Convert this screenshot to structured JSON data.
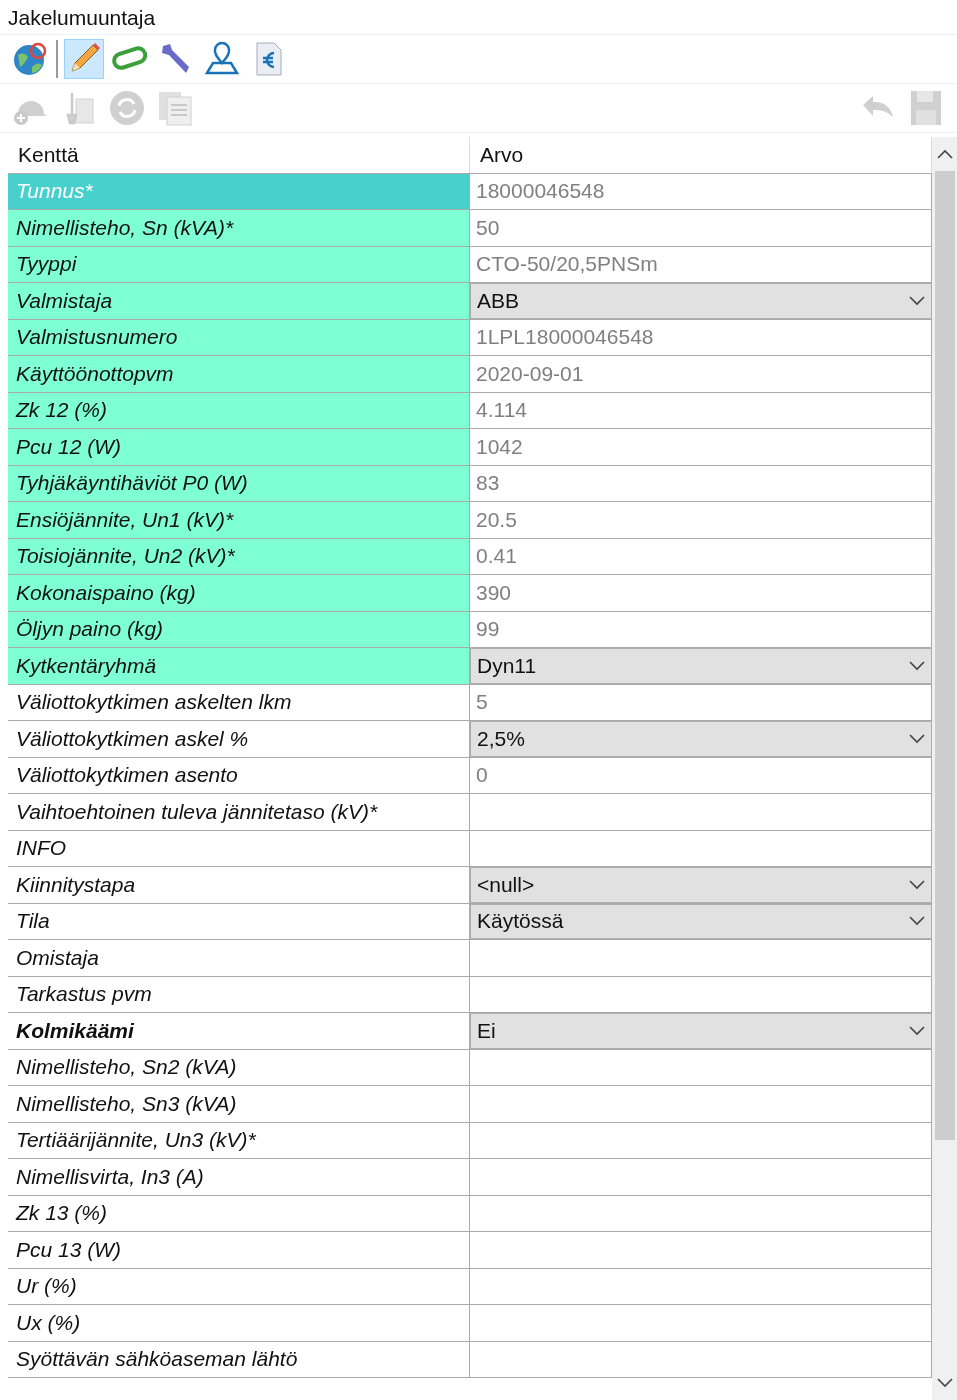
{
  "window": {
    "title": "Jakelumuuntaja"
  },
  "toolbar": [
    {
      "kind": "globe",
      "selected": false
    },
    {
      "kind": "pencil",
      "selected": true
    },
    {
      "kind": "clip",
      "selected": false
    },
    {
      "kind": "wrench",
      "selected": false
    },
    {
      "kind": "map",
      "selected": false
    },
    {
      "kind": "euro",
      "selected": false
    }
  ],
  "actions_left": [
    {
      "kind": "helmet",
      "disabled": true
    },
    {
      "kind": "shovel",
      "disabled": true
    },
    {
      "kind": "refresh",
      "disabled": true
    },
    {
      "kind": "copy",
      "disabled": true
    }
  ],
  "actions_right": [
    {
      "kind": "undo",
      "disabled": true
    },
    {
      "kind": "save",
      "disabled": true
    }
  ],
  "table": {
    "columns": [
      "Kenttä",
      "Arvo"
    ],
    "rows": [
      {
        "field": "Tunnus*",
        "value": "18000046548",
        "kind": "text",
        "selected": true,
        "required": true,
        "bold": false
      },
      {
        "field": "Nimellisteho, Sn (kVA)*",
        "value": "50",
        "kind": "text",
        "selected": false,
        "required": true,
        "bold": false
      },
      {
        "field": "Tyyppi",
        "value": "CTO-50/20,5PNSm",
        "kind": "text",
        "selected": false,
        "required": true,
        "bold": false
      },
      {
        "field": "Valmistaja",
        "value": "ABB",
        "kind": "dropdown",
        "selected": false,
        "required": true,
        "bold": false
      },
      {
        "field": "Valmistusnumero",
        "value": "1LPL18000046548",
        "kind": "text",
        "selected": false,
        "required": true,
        "bold": false
      },
      {
        "field": "Käyttöönottopvm",
        "value": "2020-09-01",
        "kind": "text",
        "selected": false,
        "required": true,
        "bold": false
      },
      {
        "field": "Zk 12 (%)",
        "value": "4.114",
        "kind": "text",
        "selected": false,
        "required": true,
        "bold": false
      },
      {
        "field": "Pcu 12 (W)",
        "value": "1042",
        "kind": "text",
        "selected": false,
        "required": true,
        "bold": false
      },
      {
        "field": "Tyhjäkäyntihäviöt P0 (W)",
        "value": "83",
        "kind": "text",
        "selected": false,
        "required": true,
        "bold": false
      },
      {
        "field": "Ensiöjännite, Un1 (kV)*",
        "value": "20.5",
        "kind": "text",
        "selected": false,
        "required": true,
        "bold": false
      },
      {
        "field": "Toisiojännite, Un2 (kV)*",
        "value": "0.41",
        "kind": "text",
        "selected": false,
        "required": true,
        "bold": false
      },
      {
        "field": "Kokonaispaino (kg)",
        "value": "390",
        "kind": "text",
        "selected": false,
        "required": true,
        "bold": false
      },
      {
        "field": "Öljyn paino (kg)",
        "value": "99",
        "kind": "text",
        "selected": false,
        "required": true,
        "bold": false
      },
      {
        "field": "Kytkentäryhmä",
        "value": "Dyn11",
        "kind": "dropdown",
        "selected": false,
        "required": true,
        "bold": false
      },
      {
        "field": "Väliottokytkimen askelten lkm",
        "value": "5",
        "kind": "text",
        "selected": false,
        "required": false,
        "bold": false
      },
      {
        "field": "Väliottokytkimen askel %",
        "value": "2,5%",
        "kind": "dropdown",
        "selected": false,
        "required": false,
        "bold": false
      },
      {
        "field": "Väliottokytkimen asento",
        "value": "0",
        "kind": "text",
        "selected": false,
        "required": false,
        "bold": false
      },
      {
        "field": "Vaihtoehtoinen tuleva jännitetaso (kV)*",
        "kind": "text",
        "selected": false,
        "required": false,
        "bold": false
      },
      {
        "field": "INFO",
        "kind": "text",
        "selected": false,
        "required": false,
        "bold": false
      },
      {
        "field": "Kiinnitystapa",
        "value": "<null>",
        "kind": "dropdown",
        "selected": false,
        "required": false,
        "bold": false
      },
      {
        "field": "Tila",
        "value": "Käytössä",
        "kind": "dropdown",
        "selected": false,
        "required": false,
        "bold": false
      },
      {
        "field": "Omistaja",
        "kind": "text",
        "selected": false,
        "required": false,
        "bold": false
      },
      {
        "field": "Tarkastus pvm",
        "kind": "text",
        "selected": false,
        "required": false,
        "bold": false
      },
      {
        "field": "Kolmikäämi",
        "value": "Ei",
        "kind": "dropdown",
        "selected": false,
        "required": false,
        "bold": true
      },
      {
        "field": "Nimellisteho, Sn2 (kVA)",
        "kind": "text",
        "selected": false,
        "required": false,
        "bold": false
      },
      {
        "field": "Nimellisteho, Sn3 (kVA)",
        "kind": "text",
        "selected": false,
        "required": false,
        "bold": false
      },
      {
        "field": "Tertiäärijännite, Un3 (kV)*",
        "kind": "text",
        "selected": false,
        "required": false,
        "bold": false
      },
      {
        "field": "Nimellisvirta, In3 (A)",
        "kind": "text",
        "selected": false,
        "required": false,
        "bold": false
      },
      {
        "field": "Zk 13 (%)",
        "kind": "text",
        "selected": false,
        "required": false,
        "bold": false
      },
      {
        "field": "Pcu 13 (W)",
        "kind": "text",
        "selected": false,
        "required": false,
        "bold": false
      },
      {
        "field": "Ur (%)",
        "kind": "text",
        "selected": false,
        "required": false,
        "bold": false
      },
      {
        "field": "Ux (%)",
        "kind": "text",
        "selected": false,
        "required": false,
        "bold": false
      },
      {
        "field": "Syöttävän sähköaseman lähtö",
        "kind": "text",
        "selected": false,
        "required": false,
        "bold": false
      }
    ]
  }
}
